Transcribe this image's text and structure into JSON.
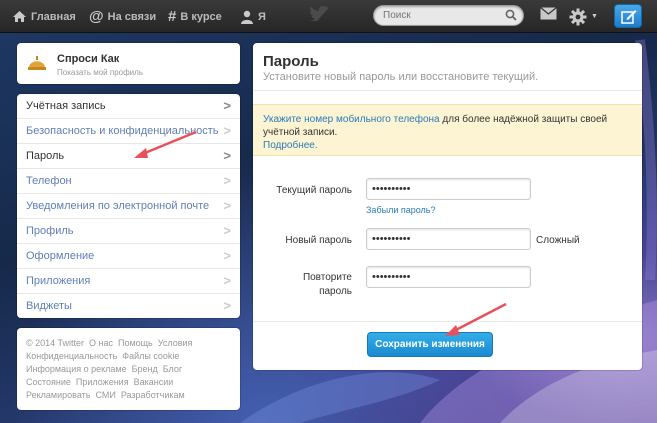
{
  "nav": {
    "home": "Главная",
    "connect": "На связи",
    "discover": "В курсе",
    "me": "Я"
  },
  "search": {
    "placeholder": "Поиск"
  },
  "profile": {
    "name": "Спроси Как",
    "link": "Показать мой профиль"
  },
  "menu": {
    "items": [
      {
        "label": "Учётная запись"
      },
      {
        "label": "Безопасность и конфиденциальность"
      },
      {
        "label": "Пароль"
      },
      {
        "label": "Телефон"
      },
      {
        "label": "Уведомления по электронной почте"
      },
      {
        "label": "Профиль"
      },
      {
        "label": "Оформление"
      },
      {
        "label": "Приложения"
      },
      {
        "label": "Виджеты"
      }
    ]
  },
  "footer": {
    "row1": [
      "© 2014 Twitter",
      "О нас",
      "Помощь",
      "Условия"
    ],
    "row2": [
      "Конфиденциальность",
      "Файлы cookie"
    ],
    "row3": [
      "Информация о рекламе",
      "Бренд",
      "Блог"
    ],
    "row4": [
      "Состояние",
      "Приложения",
      "Вакансии"
    ],
    "row5": [
      "Рекламировать",
      "СМИ",
      "Разработчикам"
    ]
  },
  "main": {
    "title": "Пароль",
    "subtitle": "Установите новый пароль или восстановите текущий.",
    "notice_link": "Укажите номер мобильного телефона",
    "notice_text": " для более надёжной защиты своей учётной записи.",
    "notice_more": "Подробнее.",
    "current_label": "Текущий пароль",
    "current_value": "••••••••••",
    "forgot": "Забыли пароль?",
    "new_label": "Новый пароль",
    "new_value": "••••••••••",
    "strength": "Сложный",
    "repeat_label_1": "Повторите",
    "repeat_label_2": "пароль",
    "repeat_value": "••••••••••",
    "save": "Сохранить изменения"
  },
  "colors": {
    "accent": "#2b7bb9",
    "button": "#1a8ad0",
    "notice_bg": "#fcf4d2",
    "annotation_arrow": "#e8505b"
  }
}
